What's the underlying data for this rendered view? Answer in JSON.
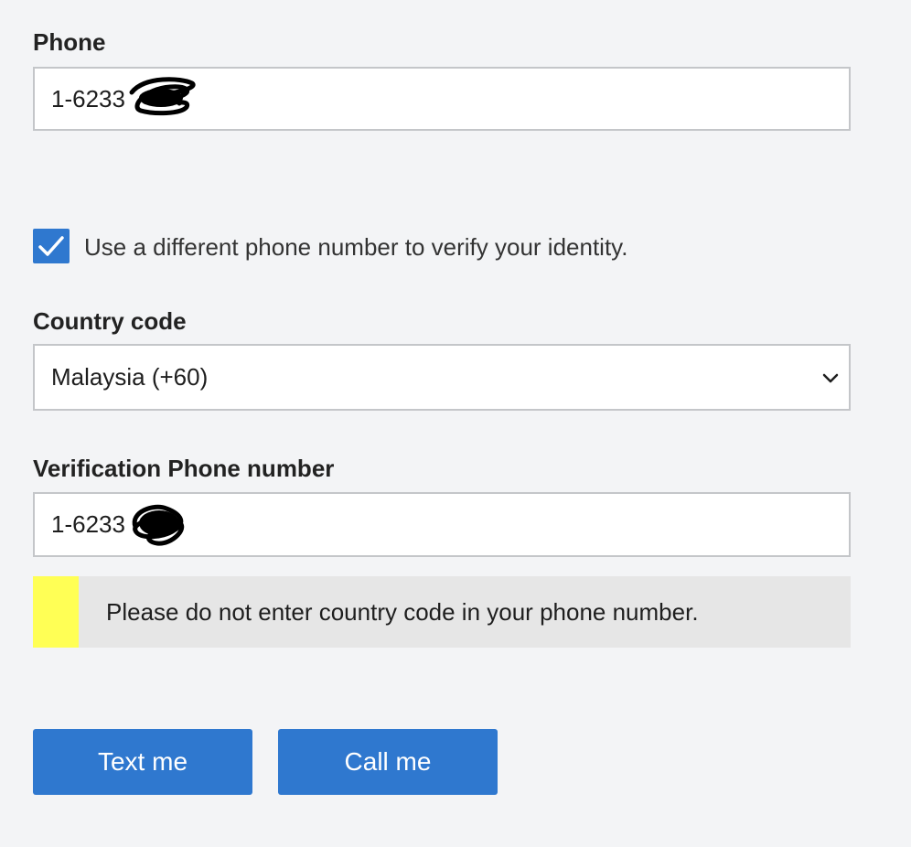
{
  "phone": {
    "label": "Phone",
    "value": "1-6233"
  },
  "use_different_number": {
    "checked": true,
    "label": "Use a different phone number to verify your identity."
  },
  "country_code": {
    "label": "Country code",
    "selected": "Malaysia (+60)"
  },
  "verification_phone": {
    "label": "Verification Phone number",
    "value": "1-6233"
  },
  "warning": {
    "message": "Please do not enter country code in your phone number.",
    "accent_color": "#ffff55"
  },
  "buttons": {
    "text_me": "Text me",
    "call_me": "Call me"
  },
  "colors": {
    "primary": "#2f78cf",
    "background": "#f3f4f6"
  }
}
